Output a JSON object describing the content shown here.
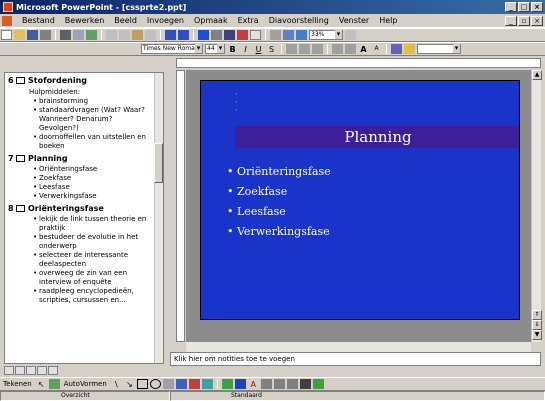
{
  "window": {
    "title": "Microsoft PowerPoint - [cssprte2.ppt]"
  },
  "menu": [
    "Bestand",
    "Bewerken",
    "Beeld",
    "Invoegen",
    "Opmaak",
    "Extra",
    "Diavoorstelling",
    "Venster",
    "Help"
  ],
  "toolbar": {
    "zoom": "33%",
    "font": "Times New Roman",
    "font_size": "44"
  },
  "outline": {
    "slides": [
      {
        "num": "6",
        "title": "Stofordening",
        "lines": [
          "Hulpmiddelen:"
        ],
        "bullets": [
          "brainstorming",
          "standaardvragen (Wat? Waar? Wanneer? Denarum? Gevolgen?)",
          "doornoffellen van uitstellen en boeken"
        ]
      },
      {
        "num": "7",
        "title": "Planning",
        "lines": [],
        "bullets": [
          "Oriënteringsfase",
          "Zoekfase",
          "Leesfase",
          "Verwerkingsfase"
        ]
      },
      {
        "num": "8",
        "title": "Oriënteringsfase",
        "lines": [],
        "bullets": [
          "lekijk de link tussen theorie en praktijk",
          "bestudeer de evolutie in het onderwerp",
          "selecteer de interessante deelaspecten",
          "overweeg de zin van een interview of enquête",
          "raadpleeg encyclopedieën, scripties, cursussen en..."
        ]
      }
    ]
  },
  "slide": {
    "title": "Planning",
    "bullets": [
      "Oriënteringsfase",
      "Zoekfase",
      "Leesfase",
      "Verwerkingsfase"
    ]
  },
  "notes": {
    "placeholder": "Klik hier om notities toe te voegen"
  },
  "drawbar": {
    "menu1": "Tekenen",
    "menu2": "AutoVormen"
  },
  "status": {
    "pane1": "Overzicht",
    "pane2": "Standaard"
  }
}
